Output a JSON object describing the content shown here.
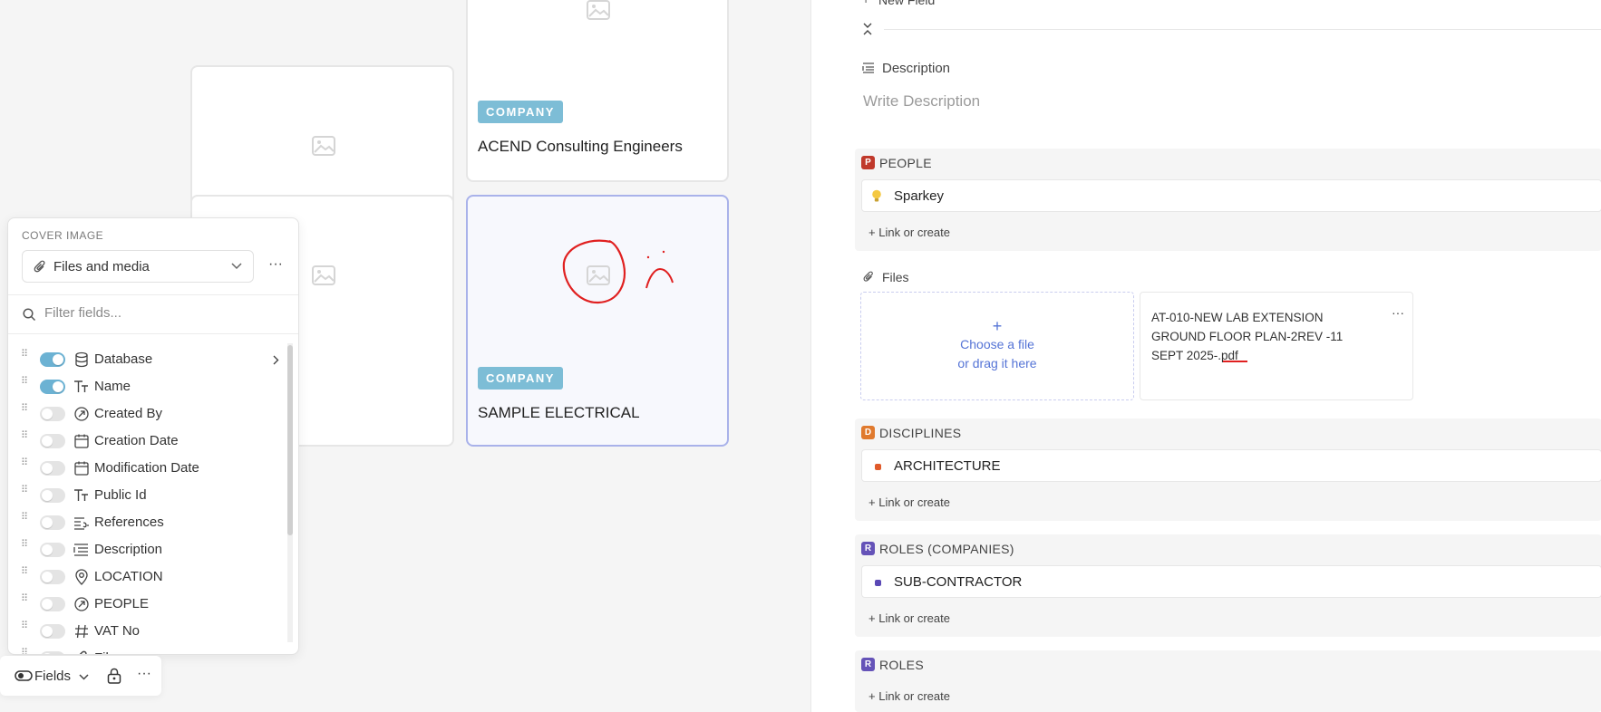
{
  "board": {
    "cards": [
      {
        "badge": "COMPANY",
        "title": "ACEND Consulting Engineers"
      },
      {
        "badge": "COMPANY",
        "title": "SAMPLE ELECTRICAL"
      }
    ]
  },
  "panel": {
    "section_label": "COVER IMAGE",
    "cover_select_value": "Files and media",
    "filter_placeholder": "Filter fields...",
    "fields": [
      {
        "label": "Database",
        "on": true,
        "icon": "database-icon"
      },
      {
        "label": "Name",
        "on": true,
        "icon": "text-type-icon"
      },
      {
        "label": "Created By",
        "on": false,
        "icon": "user-ref-icon"
      },
      {
        "label": "Creation Date",
        "on": false,
        "icon": "calendar-icon"
      },
      {
        "label": "Modification Date",
        "on": false,
        "icon": "calendar-icon"
      },
      {
        "label": "Public Id",
        "on": false,
        "icon": "text-type-icon"
      },
      {
        "label": "References",
        "on": false,
        "icon": "references-icon"
      },
      {
        "label": "Description",
        "on": false,
        "icon": "paragraph-icon"
      },
      {
        "label": "LOCATION",
        "on": false,
        "icon": "location-pin-icon"
      },
      {
        "label": "PEOPLE",
        "on": false,
        "icon": "user-ref-icon"
      },
      {
        "label": "VAT No",
        "on": false,
        "icon": "hash-icon"
      },
      {
        "label": "Files",
        "on": false,
        "icon": "paperclip-icon"
      }
    ]
  },
  "toolbar": {
    "fields_label": "Fields"
  },
  "detail": {
    "new_field_label": "New Field",
    "description_label": "Description",
    "description_placeholder": "Write Description",
    "people": {
      "letter": "P",
      "title": "PEOPLE",
      "item": "Sparkey",
      "link": "Link or create",
      "color": "#c0392b"
    },
    "files": {
      "label": "Files",
      "choose_line1": "Choose a file",
      "choose_line2": "or drag it here",
      "file_name_line1": "AT-010-NEW LAB EXTENSION",
      "file_name_line2": "GROUND FLOOR PLAN-2REV -11",
      "file_name_line3": "SEPT 2025-.pdf"
    },
    "disciplines": {
      "letter": "D",
      "title": "DISCIPLINES",
      "item": "ARCHITECTURE",
      "link": "Link or create",
      "color": "#e07a2e"
    },
    "roles_companies": {
      "letter": "R",
      "title": "ROLES (COMPANIES)",
      "item": "SUB-CONTRACTOR",
      "link": "Link or create",
      "color": "#6553b8"
    },
    "roles": {
      "letter": "R",
      "title": "ROLES",
      "link": "Link or create",
      "color": "#6553b8"
    }
  }
}
